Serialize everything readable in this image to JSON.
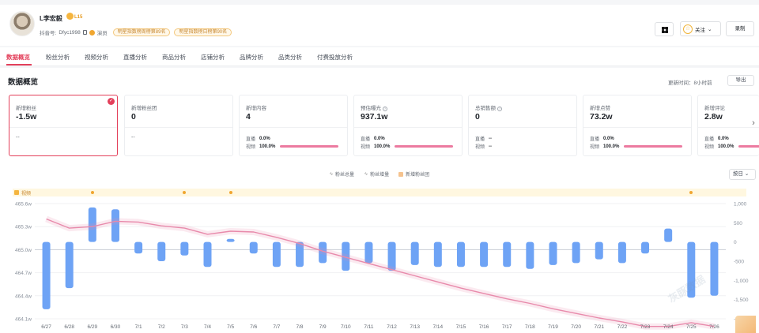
{
  "profile": {
    "name": "L李宏毅",
    "level": "L15",
    "id_label": "抖音号:",
    "id_value": "Dfyc1998",
    "role": "演员",
    "badges": [
      "明星指数榜周榜第89名",
      "明星指数榜日榜第90名"
    ],
    "follow_label": "关注",
    "record_label": "录制"
  },
  "tabs": [
    "数据概览",
    "粉丝分析",
    "视频分析",
    "直播分析",
    "商品分析",
    "店铺分析",
    "品牌分析",
    "品类分析",
    "付费投放分析"
  ],
  "overview": {
    "title": "数据概览",
    "update_time": "更新时间：8小时前",
    "export_label": "导出"
  },
  "cards": [
    {
      "title": "新增粉丝",
      "value": "-1.5w",
      "dash": "--"
    },
    {
      "title": "新增粉丝团",
      "value": "0",
      "dash": "--"
    },
    {
      "title": "新增内容",
      "value": "4",
      "live_label": "直播",
      "live_value": "0.0%",
      "video_label": "视频",
      "video_value": "100.0%"
    },
    {
      "title": "预估曝光",
      "value": "937.1w",
      "live_label": "直播",
      "live_value": "0.0%",
      "video_label": "视频",
      "video_value": "100.0%"
    },
    {
      "title": "总销售额",
      "value": "0",
      "live_label": "直播",
      "live_value": "--",
      "video_label": "视频",
      "video_value": "--"
    },
    {
      "title": "新增点赞",
      "value": "73.2w",
      "live_label": "直播",
      "live_value": "0.0%",
      "video_label": "视频",
      "video_value": "100.0%"
    },
    {
      "title": "新增评论",
      "value": "2.8w",
      "live_label": "直播",
      "live_value": "0.0%",
      "video_label": "视频",
      "video_value": "100.0%"
    }
  ],
  "legend": {
    "total": "粉丝总量",
    "increment": "粉丝增量",
    "group": "新增粉丝团"
  },
  "period_select": "按日",
  "video_track_label": "视频",
  "watermark": "灰豚数据",
  "colors": {
    "accent": "#e3405b",
    "bar": "#6ea3f5",
    "line": "#e88aab",
    "video_dot": "#f0a630"
  },
  "chart_data": {
    "type": "bar",
    "categories": [
      "6/27",
      "6/28",
      "6/29",
      "6/30",
      "7/1",
      "7/2",
      "7/3",
      "7/4",
      "7/5",
      "7/6",
      "7/7",
      "7/8",
      "7/9",
      "7/10",
      "7/11",
      "7/12",
      "7/13",
      "7/14",
      "7/15",
      "7/16",
      "7/17",
      "7/18",
      "7/19",
      "7/20",
      "7/21",
      "7/22",
      "7/23",
      "7/24",
      "7/25",
      "7/26"
    ],
    "series": [
      {
        "axis": "right",
        "type": "bar",
        "values": [
          -1750,
          -1200,
          900,
          850,
          -300,
          -500,
          -350,
          -650,
          80,
          -300,
          -650,
          -650,
          -550,
          -750,
          -550,
          -750,
          -600,
          -650,
          -650,
          -650,
          -650,
          -700,
          -600,
          -550,
          -450,
          -550,
          -300,
          350,
          -1450,
          -1400
        ]
      },
      {
        "axis": "left",
        "type": "line",
        "values": [
          465.4,
          465.28,
          465.3,
          465.37,
          465.36,
          465.31,
          465.28,
          465.2,
          465.24,
          465.23,
          465.16,
          465.08,
          464.98,
          464.9,
          464.82,
          464.74,
          464.66,
          464.58,
          464.5,
          464.43,
          464.36,
          464.3,
          464.23,
          464.17,
          464.11,
          464.06,
          464.0,
          464.0,
          464.05,
          464.0
        ]
      }
    ],
    "left_ticks": [
      "465.6w",
      "465.3w",
      "465.0w",
      "464.7w",
      "464.4w",
      "464.1w"
    ],
    "right_ticks": [
      "1,000",
      "500",
      "0",
      "-500",
      "-1,000",
      "-1,500",
      "-2,000"
    ],
    "video_days": [
      "6/29",
      "7/3",
      "7/5",
      "7/25"
    ]
  }
}
